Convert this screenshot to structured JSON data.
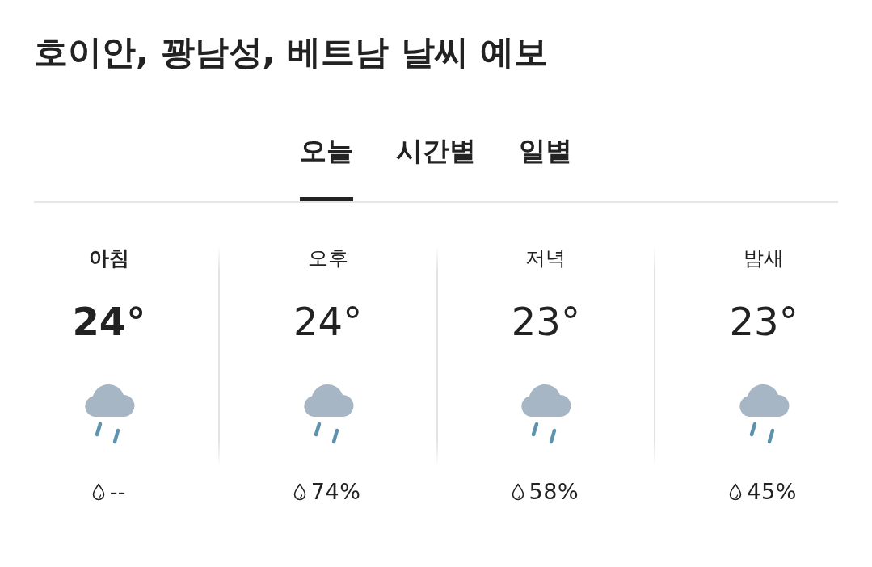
{
  "title": "호이안, 꽝남성, 베트남 날씨 예보",
  "tabs": [
    {
      "label": "오늘",
      "selected": true
    },
    {
      "label": "시간별",
      "selected": false
    },
    {
      "label": "일별",
      "selected": false
    }
  ],
  "periods": [
    {
      "label": "아침",
      "selected": true,
      "temperature": "24°",
      "precipitation": "--"
    },
    {
      "label": "오후",
      "selected": false,
      "temperature": "24°",
      "precipitation": "74%"
    },
    {
      "label": "저녁",
      "selected": false,
      "temperature": "23°",
      "precipitation": "58%"
    },
    {
      "label": "밤새",
      "selected": false,
      "temperature": "23°",
      "precipitation": "45%"
    }
  ]
}
